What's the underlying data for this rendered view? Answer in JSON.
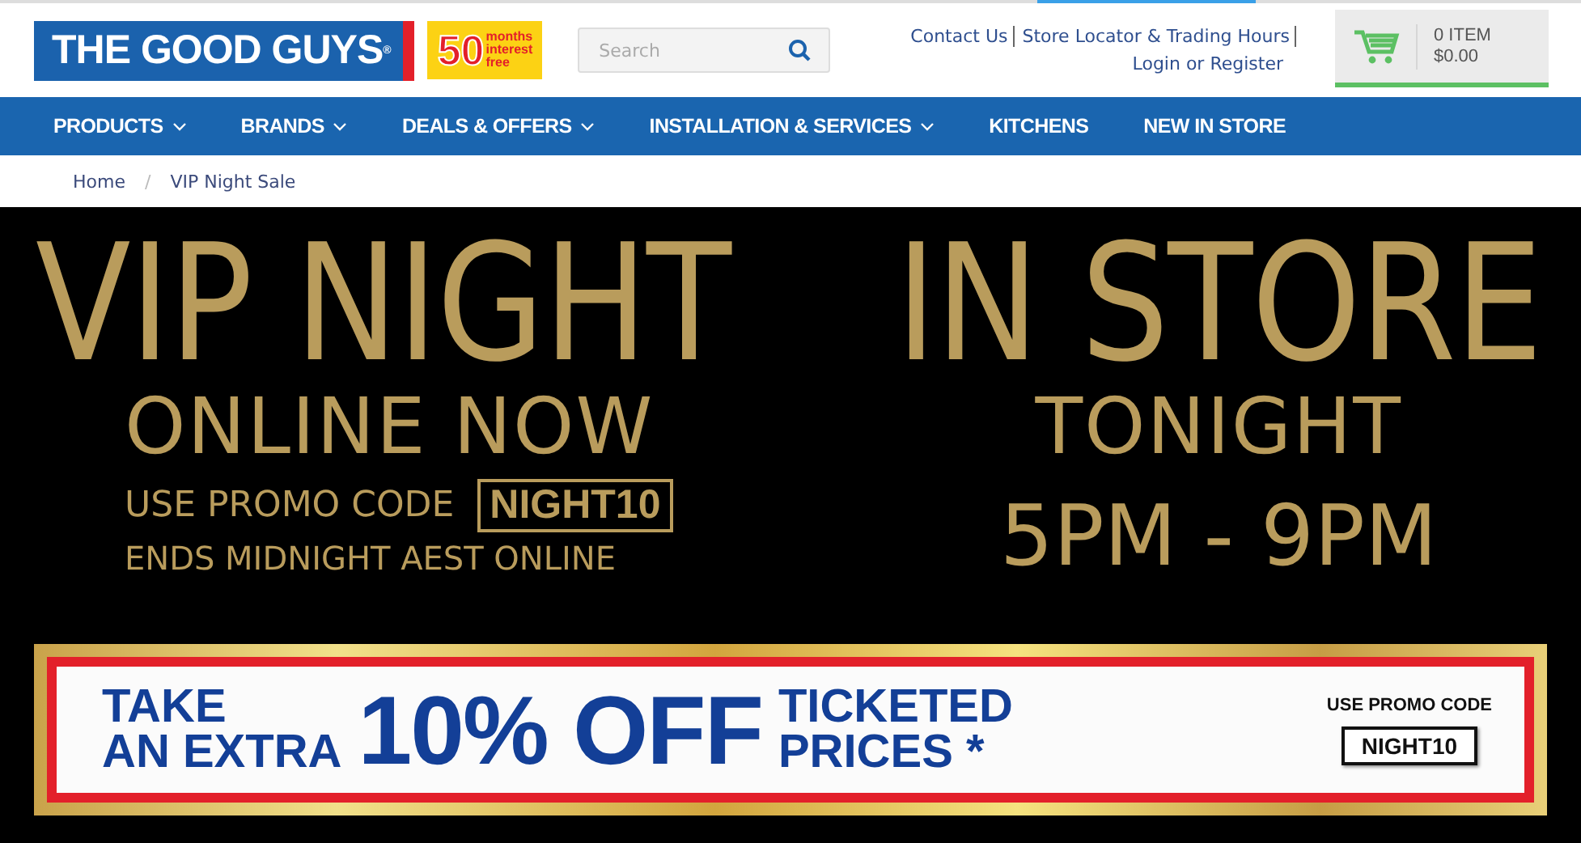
{
  "header": {
    "logo": "THE GOOD GUYS$^{®}$",
    "offer_number": "50",
    "offer_text": [
      "months",
      "interest",
      "free"
    ],
    "search": {
      "placeholder": "Search"
    },
    "links": [
      "Contact Us",
      "Store Locator & Trading Hours"
    ],
    "account_link": "Login or Register",
    "cart": {
      "count": "0 ITEM",
      "total": "$0.00"
    }
  },
  "nav": [
    {
      "label": "PRODUCTS",
      "dropdown": true
    },
    {
      "label": "BRANDS",
      "dropdown": true
    },
    {
      "label": "DEALS & OFFERS",
      "dropdown": true
    },
    {
      "label": "INSTALLATION & SERVICES",
      "dropdown": true
    },
    {
      "label": "KITCHENS",
      "dropdown": false
    },
    {
      "label": "NEW IN STORE",
      "dropdown": false
    }
  ],
  "breadcrumb": {
    "items": [
      "Home",
      "VIP Night Sale"
    ],
    "separator": "/"
  },
  "hero": {
    "left": {
      "title": "VIP NIGHT",
      "subtitle": "ONLINE NOW",
      "promo_label": "USE PROMO CODE",
      "promo_code": "NIGHT10",
      "note": "ENDS MIDNIGHT AEST ONLINE"
    },
    "right": {
      "title": "IN STORE",
      "subtitle": "TONIGHT",
      "hours": "5PM - 9PM"
    }
  },
  "promo": {
    "lead": [
      "TAKE",
      "AN EXTRA"
    ],
    "amount": "10% OFF",
    "tail": [
      "TICKETED",
      "PRICES *"
    ],
    "code_label": "USE PROMO CODE",
    "code": "NIGHT10"
  }
}
